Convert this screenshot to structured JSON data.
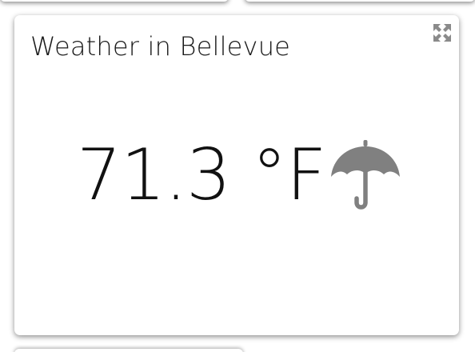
{
  "widget": {
    "title": "Weather in Bellevue",
    "temperature": "71.3 °F",
    "condition_icon": "umbrella-icon",
    "expand_icon": "expand-icon"
  },
  "colors": {
    "icon_gray": "#808080",
    "text": "#111111",
    "background": "#ffffff"
  }
}
